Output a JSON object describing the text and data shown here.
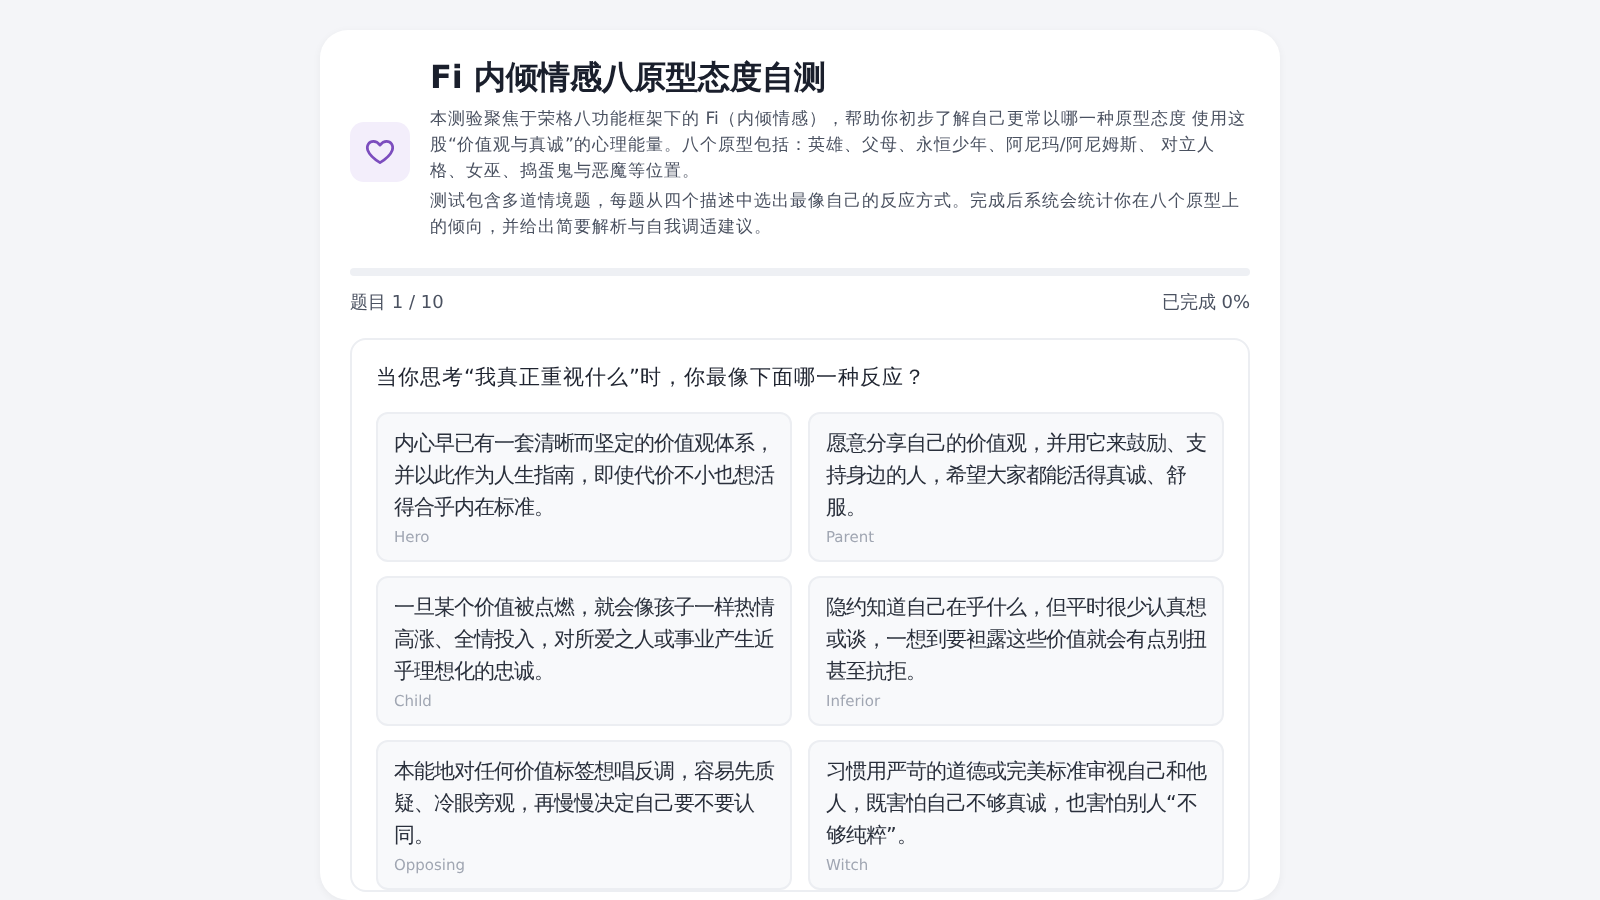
{
  "header": {
    "title": "Fi 内倾情感八原型态度自测",
    "paragraphs": [
      "本测验聚焦于荣格八功能框架下的 Fi（内倾情感），帮助你初步了解自己更常以哪一种原型态度 使用这股“价值观与真诚”的心理能量。八个原型包括：英雄、父母、永恒少年、阿尼玛/阿尼姆斯、 对立人格、女巫、捣蛋鬼与恶魔等位置。",
      "测试包含多道情境题，每题从四个描述中选出最像自己的反应方式。完成后系统会统计你在八个原型上的倾向，并给出简要解析与自我调适建议。"
    ]
  },
  "progress": {
    "question_counter": "题目 1 / 10",
    "completed": "已完成 0%"
  },
  "question": {
    "text": "当你思考“我真正重视什么”时，你最像下面哪一种反应？",
    "options": [
      {
        "text": "内心早已有一套清晰而坚定的价值观体系，并以此作为人生指南，即使代价不小也想活得合乎内在标准。",
        "tag": "Hero",
        "selected": false
      },
      {
        "text": "愿意分享自己的价值观，并用它来鼓励、支持身边的人，希望大家都能活得真诚、舒服。",
        "tag": "Parent",
        "selected": false
      },
      {
        "text": "一旦某个价值被点燃，就会像孩子一样热情高涨、全情投入，对所爱之人或事业产生近乎理想化的忠诚。",
        "tag": "Child",
        "selected": false
      },
      {
        "text": "隐约知道自己在乎什么，但平时很少认真想或谈，一想到要袒露这些价值就会有点别扭甚至抗拒。",
        "tag": "Inferior",
        "selected": false
      },
      {
        "text": "本能地对任何价值标签想唱反调，容易先质疑、冷眼旁观，再慢慢决定自己要不要认同。",
        "tag": "Opposing",
        "selected": false
      },
      {
        "text": "习惯用严苛的道德或完美标准审视自己和他人，既害怕自己不够真诚，也害怕别人“不够纯粹”。",
        "tag": "Witch",
        "selected": false
      }
    ]
  }
}
